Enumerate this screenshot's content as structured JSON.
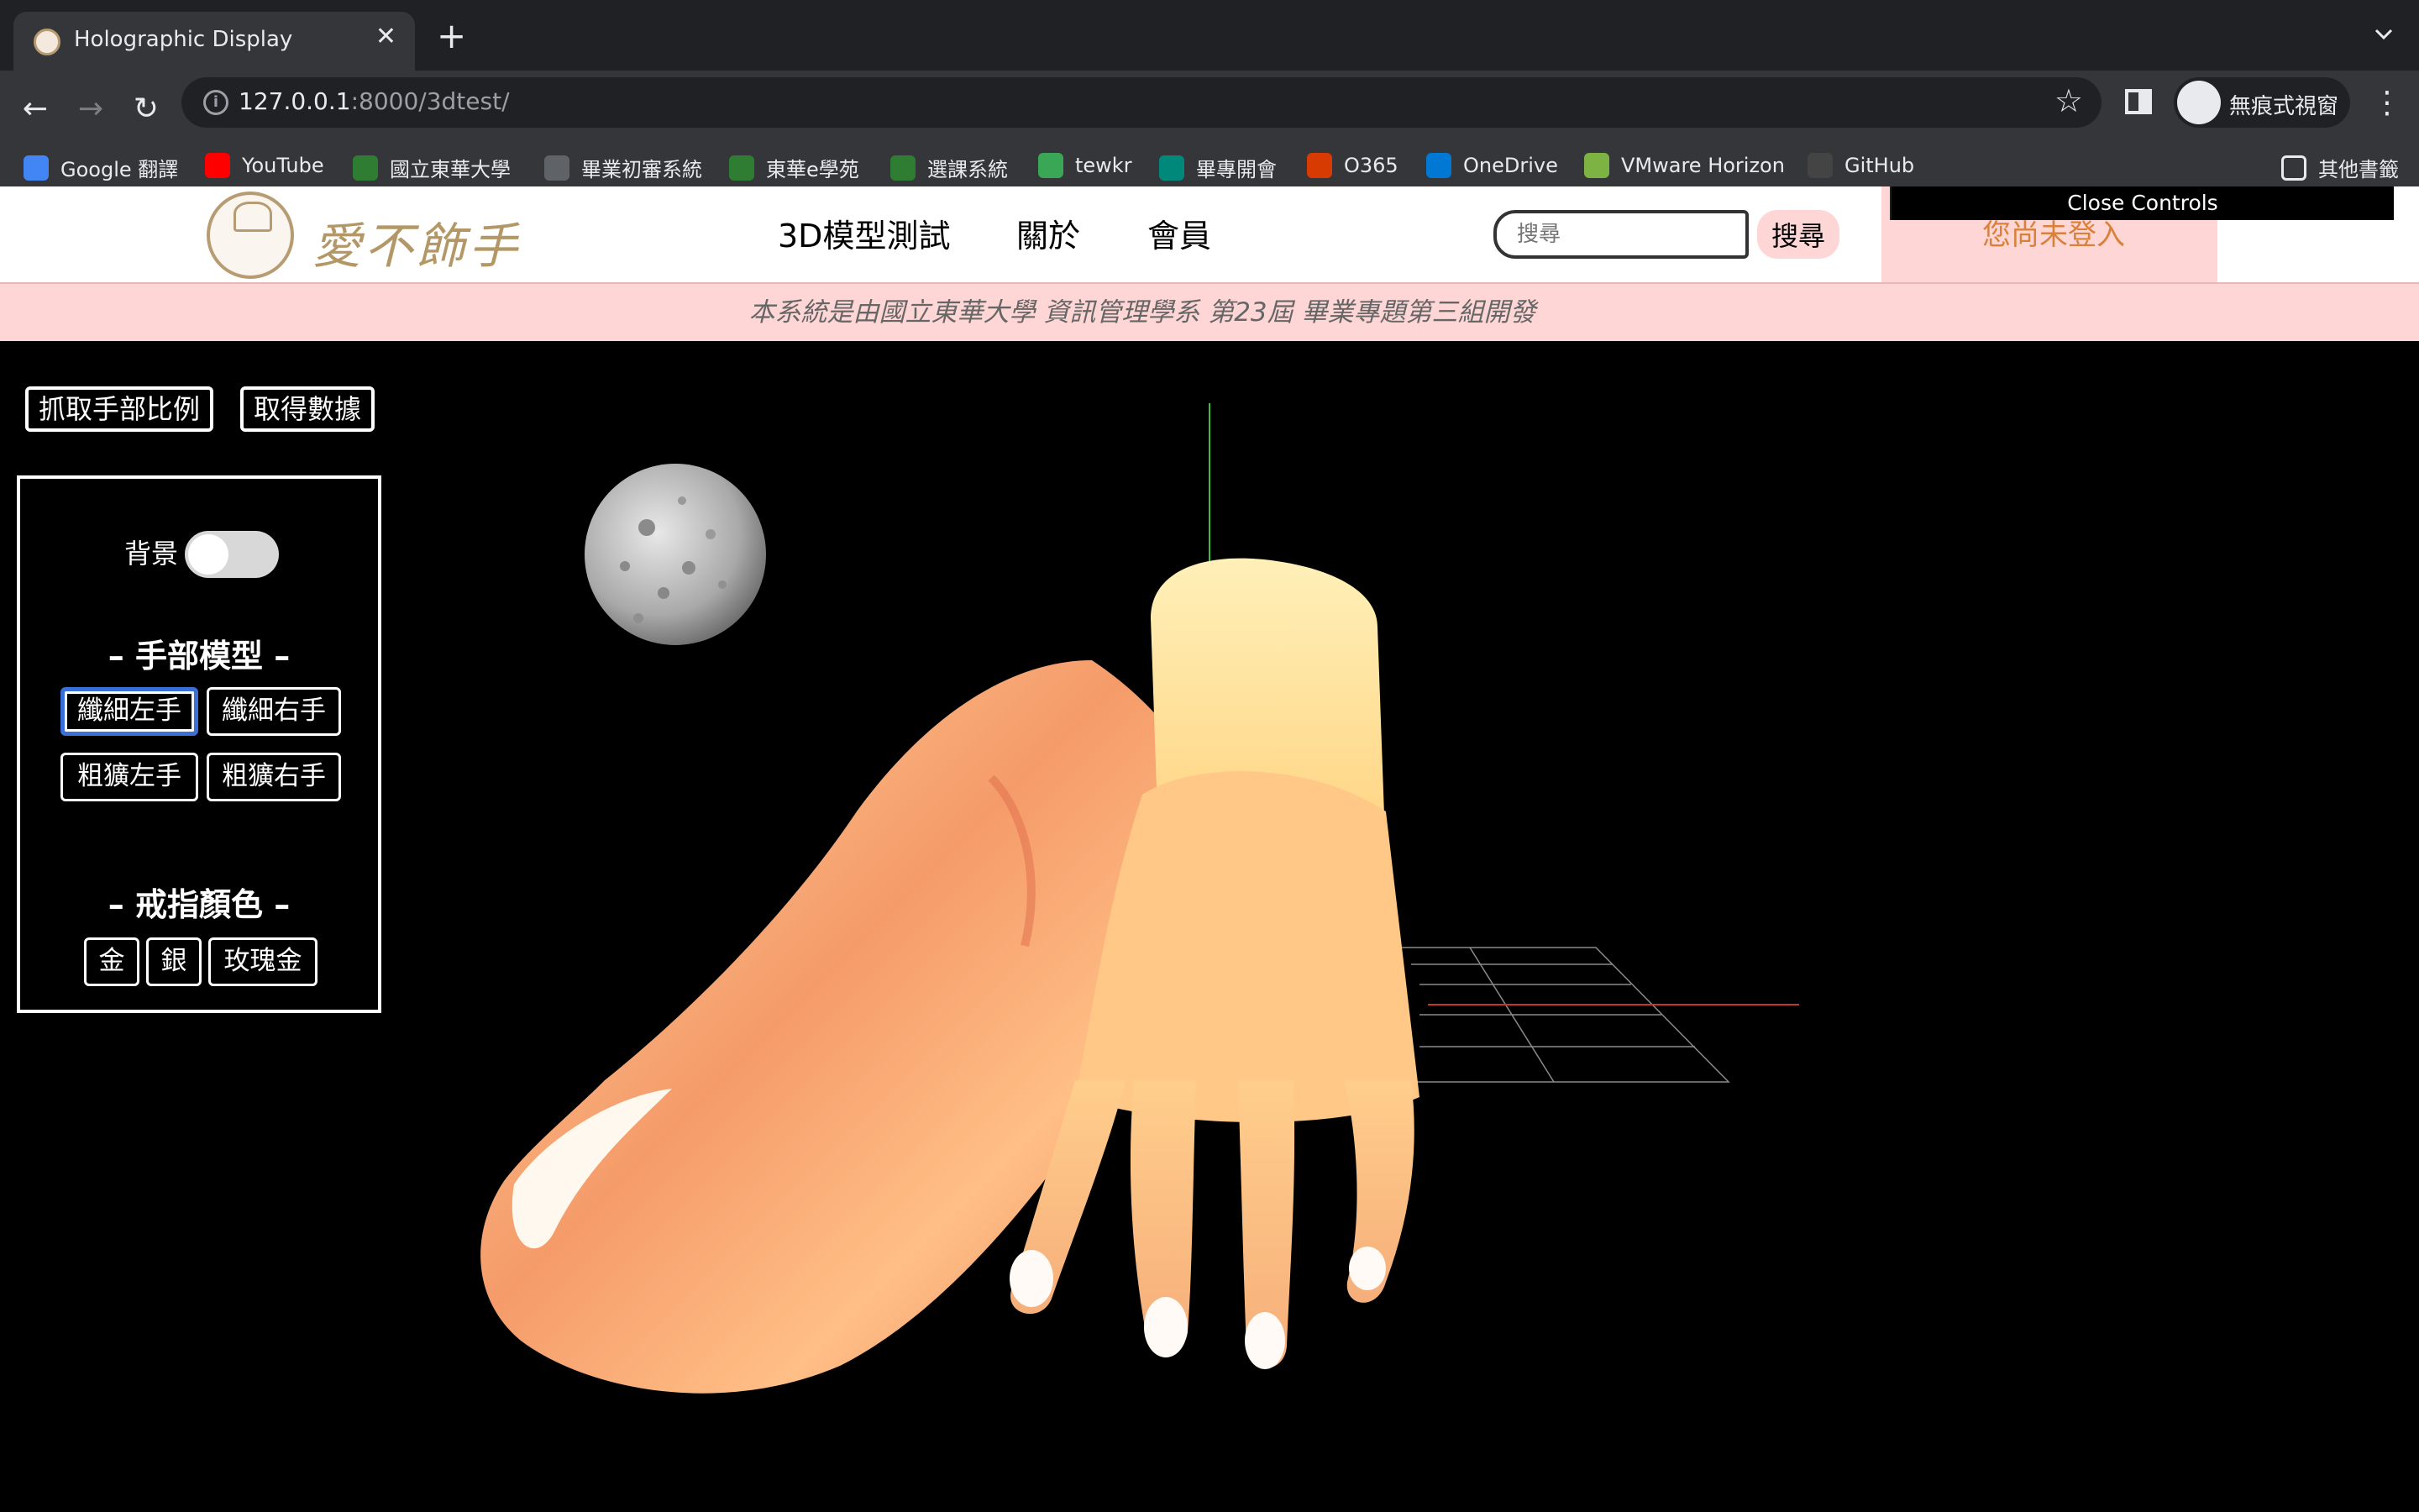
{
  "browser": {
    "tab_title": "Holographic Display",
    "url_host": "127.0.0.1",
    "url_rest": ":8000/3dtest/",
    "profile_label": "無痕式視窗",
    "bookmarks": [
      {
        "label": "Google 翻譯",
        "color": "#4285f4"
      },
      {
        "label": "YouTube",
        "color": "#ff0000"
      },
      {
        "label": "國立東華大學",
        "color": "#2e7d32"
      },
      {
        "label": "畢業初審系統",
        "color": "#5f6368"
      },
      {
        "label": "東華e學苑",
        "color": "#2e7d32"
      },
      {
        "label": "選課系統",
        "color": "#2e7d32"
      },
      {
        "label": "tewkr",
        "color": "#3aa757"
      },
      {
        "label": "畢專開會",
        "color": "#00897b"
      },
      {
        "label": "O365",
        "color": "#d83b01"
      },
      {
        "label": "OneDrive",
        "color": "#0078d4"
      },
      {
        "label": "VMware Horizon",
        "color": "#7cb342"
      },
      {
        "label": "GitHub",
        "color": "#444"
      }
    ],
    "other_bookmarks": "其他書籤"
  },
  "site": {
    "logo_text": "愛不飾手",
    "nav": [
      "3D模型測試",
      "關於",
      "會員"
    ],
    "search_placeholder": "搜尋",
    "search_button": "搜尋",
    "login_status": "您尚未登入",
    "close_controls": "Close Controls",
    "banner": "本系統是由國立東華大學 資訊管理學系 第23屆 畢業專題第三組開發"
  },
  "viewer": {
    "top_buttons": [
      "抓取手部比例",
      "取得數據"
    ],
    "background_label": "背景",
    "background_on": false,
    "hand_section_title": "– 手部模型 –",
    "hand_models": [
      "纖細左手",
      "纖細右手",
      "粗獷左手",
      "粗獷右手"
    ],
    "selected_hand": "纖細左手",
    "ring_section_title": "– 戒指顏色 –",
    "ring_colors": [
      "金",
      "銀",
      "玫瑰金"
    ]
  },
  "colors": {
    "accent_pink": "#ffd6d6",
    "login_orange": "#d9813a",
    "logo_gold": "#b49766",
    "selected_blue": "#3a6fd8"
  }
}
